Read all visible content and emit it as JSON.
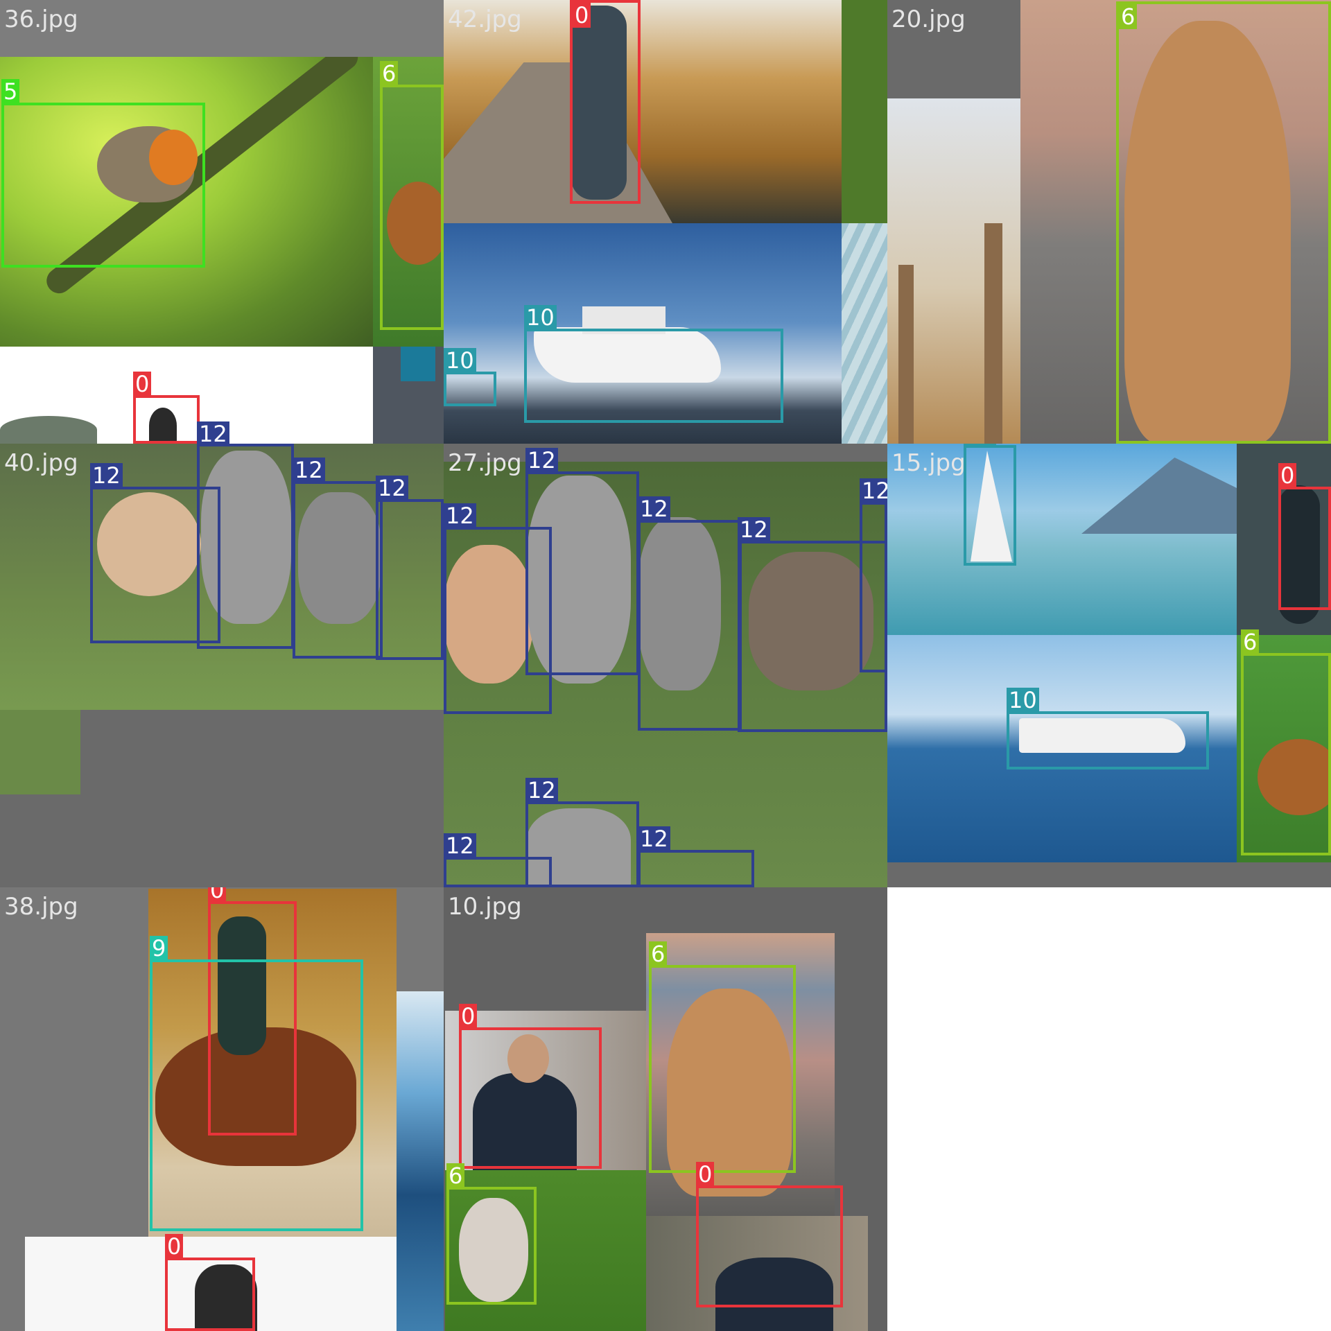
{
  "colors": {
    "person": "#e8343b",
    "bird": "#3ee021",
    "dog": "#8cc520",
    "boat": "#2a9aa8",
    "horse": "#22c3a8",
    "cat": "#2f3f8f"
  },
  "tiles": [
    {
      "name": "36.jpg",
      "boxes": [
        {
          "label": "5"
        },
        {
          "label": "6"
        },
        {
          "label": "0"
        },
        {
          "label": "12"
        }
      ]
    },
    {
      "name": "42.jpg",
      "boxes": [
        {
          "label": "0"
        },
        {
          "label": "10"
        },
        {
          "label": "10"
        }
      ]
    },
    {
      "name": "20.jpg",
      "boxes": [
        {
          "label": "6"
        }
      ]
    },
    {
      "name": "40.jpg",
      "boxes": [
        {
          "label": "12"
        },
        {
          "label": "12"
        },
        {
          "label": "12"
        }
      ]
    },
    {
      "name": "27.jpg",
      "boxes": [
        {
          "label": "12"
        },
        {
          "label": "12"
        },
        {
          "label": "12"
        },
        {
          "label": "12"
        },
        {
          "label": "12"
        },
        {
          "label": "12"
        },
        {
          "label": "12"
        },
        {
          "label": "12"
        }
      ]
    },
    {
      "name": "15.jpg",
      "boxes": [
        {
          "label": "10"
        },
        {
          "label": "0"
        },
        {
          "label": "10"
        },
        {
          "label": "6"
        }
      ]
    },
    {
      "name": "38.jpg",
      "boxes": [
        {
          "label": "0"
        },
        {
          "label": "9"
        },
        {
          "label": "0"
        }
      ]
    },
    {
      "name": "10.jpg",
      "boxes": [
        {
          "label": "6"
        },
        {
          "label": "0"
        },
        {
          "label": "6"
        },
        {
          "label": "0"
        }
      ]
    }
  ]
}
